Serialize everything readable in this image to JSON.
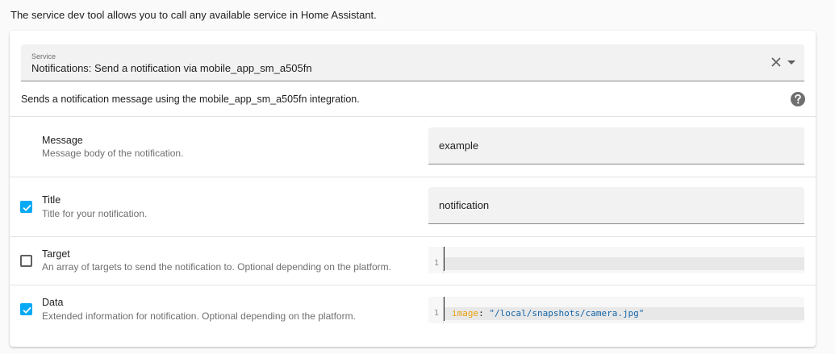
{
  "intro_text": "The service dev tool allows you to call any available service in Home Assistant.",
  "service_select": {
    "label": "Service",
    "value": "Notifications: Send a notification via mobile_app_sm_a505fn",
    "description": "Sends a notification message using the mobile_app_sm_a505fn integration."
  },
  "fields": {
    "message": {
      "name": "Message",
      "description": "Message body of the notification.",
      "value": "example"
    },
    "title": {
      "name": "Title",
      "description": "Title for your notification.",
      "value": "notification",
      "checked": true
    },
    "target": {
      "name": "Target",
      "description": "An array of targets to send the notification to. Optional depending on the platform.",
      "line_number": "1",
      "checked": false
    },
    "data": {
      "name": "Data",
      "description": "Extended information for notification. Optional depending on the platform.",
      "line_number": "1",
      "code_key": "image",
      "code_separator": ": ",
      "code_value": "\"/local/snapshots/camera.jpg\"",
      "checked": true
    }
  },
  "colors": {
    "accent": "#03a9f4",
    "yaml_key": "#e89f0b",
    "yaml_string": "#1565a8"
  }
}
